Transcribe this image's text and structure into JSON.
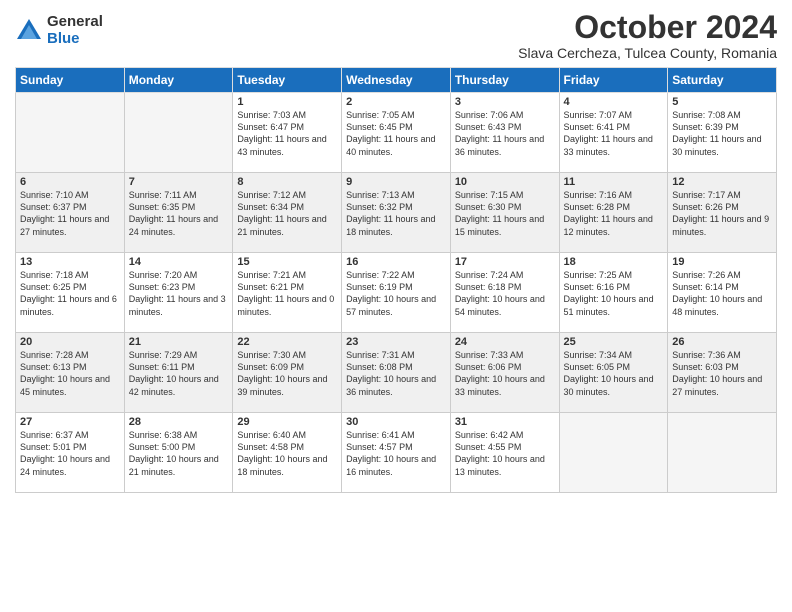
{
  "logo": {
    "general": "General",
    "blue": "Blue"
  },
  "header": {
    "month": "October 2024",
    "location": "Slava Cercheza, Tulcea County, Romania"
  },
  "weekdays": [
    "Sunday",
    "Monday",
    "Tuesday",
    "Wednesday",
    "Thursday",
    "Friday",
    "Saturday"
  ],
  "weeks": [
    [
      {
        "day": "",
        "info": ""
      },
      {
        "day": "",
        "info": ""
      },
      {
        "day": "1",
        "info": "Sunrise: 7:03 AM\nSunset: 6:47 PM\nDaylight: 11 hours and 43 minutes."
      },
      {
        "day": "2",
        "info": "Sunrise: 7:05 AM\nSunset: 6:45 PM\nDaylight: 11 hours and 40 minutes."
      },
      {
        "day": "3",
        "info": "Sunrise: 7:06 AM\nSunset: 6:43 PM\nDaylight: 11 hours and 36 minutes."
      },
      {
        "day": "4",
        "info": "Sunrise: 7:07 AM\nSunset: 6:41 PM\nDaylight: 11 hours and 33 minutes."
      },
      {
        "day": "5",
        "info": "Sunrise: 7:08 AM\nSunset: 6:39 PM\nDaylight: 11 hours and 30 minutes."
      }
    ],
    [
      {
        "day": "6",
        "info": "Sunrise: 7:10 AM\nSunset: 6:37 PM\nDaylight: 11 hours and 27 minutes."
      },
      {
        "day": "7",
        "info": "Sunrise: 7:11 AM\nSunset: 6:35 PM\nDaylight: 11 hours and 24 minutes."
      },
      {
        "day": "8",
        "info": "Sunrise: 7:12 AM\nSunset: 6:34 PM\nDaylight: 11 hours and 21 minutes."
      },
      {
        "day": "9",
        "info": "Sunrise: 7:13 AM\nSunset: 6:32 PM\nDaylight: 11 hours and 18 minutes."
      },
      {
        "day": "10",
        "info": "Sunrise: 7:15 AM\nSunset: 6:30 PM\nDaylight: 11 hours and 15 minutes."
      },
      {
        "day": "11",
        "info": "Sunrise: 7:16 AM\nSunset: 6:28 PM\nDaylight: 11 hours and 12 minutes."
      },
      {
        "day": "12",
        "info": "Sunrise: 7:17 AM\nSunset: 6:26 PM\nDaylight: 11 hours and 9 minutes."
      }
    ],
    [
      {
        "day": "13",
        "info": "Sunrise: 7:18 AM\nSunset: 6:25 PM\nDaylight: 11 hours and 6 minutes."
      },
      {
        "day": "14",
        "info": "Sunrise: 7:20 AM\nSunset: 6:23 PM\nDaylight: 11 hours and 3 minutes."
      },
      {
        "day": "15",
        "info": "Sunrise: 7:21 AM\nSunset: 6:21 PM\nDaylight: 11 hours and 0 minutes."
      },
      {
        "day": "16",
        "info": "Sunrise: 7:22 AM\nSunset: 6:19 PM\nDaylight: 10 hours and 57 minutes."
      },
      {
        "day": "17",
        "info": "Sunrise: 7:24 AM\nSunset: 6:18 PM\nDaylight: 10 hours and 54 minutes."
      },
      {
        "day": "18",
        "info": "Sunrise: 7:25 AM\nSunset: 6:16 PM\nDaylight: 10 hours and 51 minutes."
      },
      {
        "day": "19",
        "info": "Sunrise: 7:26 AM\nSunset: 6:14 PM\nDaylight: 10 hours and 48 minutes."
      }
    ],
    [
      {
        "day": "20",
        "info": "Sunrise: 7:28 AM\nSunset: 6:13 PM\nDaylight: 10 hours and 45 minutes."
      },
      {
        "day": "21",
        "info": "Sunrise: 7:29 AM\nSunset: 6:11 PM\nDaylight: 10 hours and 42 minutes."
      },
      {
        "day": "22",
        "info": "Sunrise: 7:30 AM\nSunset: 6:09 PM\nDaylight: 10 hours and 39 minutes."
      },
      {
        "day": "23",
        "info": "Sunrise: 7:31 AM\nSunset: 6:08 PM\nDaylight: 10 hours and 36 minutes."
      },
      {
        "day": "24",
        "info": "Sunrise: 7:33 AM\nSunset: 6:06 PM\nDaylight: 10 hours and 33 minutes."
      },
      {
        "day": "25",
        "info": "Sunrise: 7:34 AM\nSunset: 6:05 PM\nDaylight: 10 hours and 30 minutes."
      },
      {
        "day": "26",
        "info": "Sunrise: 7:36 AM\nSunset: 6:03 PM\nDaylight: 10 hours and 27 minutes."
      }
    ],
    [
      {
        "day": "27",
        "info": "Sunrise: 6:37 AM\nSunset: 5:01 PM\nDaylight: 10 hours and 24 minutes."
      },
      {
        "day": "28",
        "info": "Sunrise: 6:38 AM\nSunset: 5:00 PM\nDaylight: 10 hours and 21 minutes."
      },
      {
        "day": "29",
        "info": "Sunrise: 6:40 AM\nSunset: 4:58 PM\nDaylight: 10 hours and 18 minutes."
      },
      {
        "day": "30",
        "info": "Sunrise: 6:41 AM\nSunset: 4:57 PM\nDaylight: 10 hours and 16 minutes."
      },
      {
        "day": "31",
        "info": "Sunrise: 6:42 AM\nSunset: 4:55 PM\nDaylight: 10 hours and 13 minutes."
      },
      {
        "day": "",
        "info": ""
      },
      {
        "day": "",
        "info": ""
      }
    ]
  ]
}
